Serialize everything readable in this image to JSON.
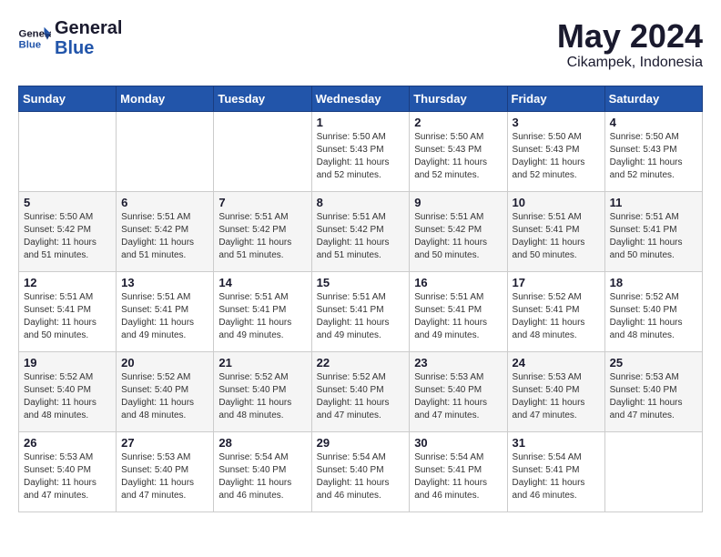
{
  "header": {
    "logo_general": "General",
    "logo_blue": "Blue",
    "month_title": "May 2024",
    "location": "Cikampek, Indonesia"
  },
  "weekdays": [
    "Sunday",
    "Monday",
    "Tuesday",
    "Wednesday",
    "Thursday",
    "Friday",
    "Saturday"
  ],
  "weeks": [
    [
      {
        "day": "",
        "info": ""
      },
      {
        "day": "",
        "info": ""
      },
      {
        "day": "",
        "info": ""
      },
      {
        "day": "1",
        "info": "Sunrise: 5:50 AM\nSunset: 5:43 PM\nDaylight: 11 hours\nand 52 minutes."
      },
      {
        "day": "2",
        "info": "Sunrise: 5:50 AM\nSunset: 5:43 PM\nDaylight: 11 hours\nand 52 minutes."
      },
      {
        "day": "3",
        "info": "Sunrise: 5:50 AM\nSunset: 5:43 PM\nDaylight: 11 hours\nand 52 minutes."
      },
      {
        "day": "4",
        "info": "Sunrise: 5:50 AM\nSunset: 5:43 PM\nDaylight: 11 hours\nand 52 minutes."
      }
    ],
    [
      {
        "day": "5",
        "info": "Sunrise: 5:50 AM\nSunset: 5:42 PM\nDaylight: 11 hours\nand 51 minutes."
      },
      {
        "day": "6",
        "info": "Sunrise: 5:51 AM\nSunset: 5:42 PM\nDaylight: 11 hours\nand 51 minutes."
      },
      {
        "day": "7",
        "info": "Sunrise: 5:51 AM\nSunset: 5:42 PM\nDaylight: 11 hours\nand 51 minutes."
      },
      {
        "day": "8",
        "info": "Sunrise: 5:51 AM\nSunset: 5:42 PM\nDaylight: 11 hours\nand 51 minutes."
      },
      {
        "day": "9",
        "info": "Sunrise: 5:51 AM\nSunset: 5:42 PM\nDaylight: 11 hours\nand 50 minutes."
      },
      {
        "day": "10",
        "info": "Sunrise: 5:51 AM\nSunset: 5:41 PM\nDaylight: 11 hours\nand 50 minutes."
      },
      {
        "day": "11",
        "info": "Sunrise: 5:51 AM\nSunset: 5:41 PM\nDaylight: 11 hours\nand 50 minutes."
      }
    ],
    [
      {
        "day": "12",
        "info": "Sunrise: 5:51 AM\nSunset: 5:41 PM\nDaylight: 11 hours\nand 50 minutes."
      },
      {
        "day": "13",
        "info": "Sunrise: 5:51 AM\nSunset: 5:41 PM\nDaylight: 11 hours\nand 49 minutes."
      },
      {
        "day": "14",
        "info": "Sunrise: 5:51 AM\nSunset: 5:41 PM\nDaylight: 11 hours\nand 49 minutes."
      },
      {
        "day": "15",
        "info": "Sunrise: 5:51 AM\nSunset: 5:41 PM\nDaylight: 11 hours\nand 49 minutes."
      },
      {
        "day": "16",
        "info": "Sunrise: 5:51 AM\nSunset: 5:41 PM\nDaylight: 11 hours\nand 49 minutes."
      },
      {
        "day": "17",
        "info": "Sunrise: 5:52 AM\nSunset: 5:41 PM\nDaylight: 11 hours\nand 48 minutes."
      },
      {
        "day": "18",
        "info": "Sunrise: 5:52 AM\nSunset: 5:40 PM\nDaylight: 11 hours\nand 48 minutes."
      }
    ],
    [
      {
        "day": "19",
        "info": "Sunrise: 5:52 AM\nSunset: 5:40 PM\nDaylight: 11 hours\nand 48 minutes."
      },
      {
        "day": "20",
        "info": "Sunrise: 5:52 AM\nSunset: 5:40 PM\nDaylight: 11 hours\nand 48 minutes."
      },
      {
        "day": "21",
        "info": "Sunrise: 5:52 AM\nSunset: 5:40 PM\nDaylight: 11 hours\nand 48 minutes."
      },
      {
        "day": "22",
        "info": "Sunrise: 5:52 AM\nSunset: 5:40 PM\nDaylight: 11 hours\nand 47 minutes."
      },
      {
        "day": "23",
        "info": "Sunrise: 5:53 AM\nSunset: 5:40 PM\nDaylight: 11 hours\nand 47 minutes."
      },
      {
        "day": "24",
        "info": "Sunrise: 5:53 AM\nSunset: 5:40 PM\nDaylight: 11 hours\nand 47 minutes."
      },
      {
        "day": "25",
        "info": "Sunrise: 5:53 AM\nSunset: 5:40 PM\nDaylight: 11 hours\nand 47 minutes."
      }
    ],
    [
      {
        "day": "26",
        "info": "Sunrise: 5:53 AM\nSunset: 5:40 PM\nDaylight: 11 hours\nand 47 minutes."
      },
      {
        "day": "27",
        "info": "Sunrise: 5:53 AM\nSunset: 5:40 PM\nDaylight: 11 hours\nand 47 minutes."
      },
      {
        "day": "28",
        "info": "Sunrise: 5:54 AM\nSunset: 5:40 PM\nDaylight: 11 hours\nand 46 minutes."
      },
      {
        "day": "29",
        "info": "Sunrise: 5:54 AM\nSunset: 5:40 PM\nDaylight: 11 hours\nand 46 minutes."
      },
      {
        "day": "30",
        "info": "Sunrise: 5:54 AM\nSunset: 5:41 PM\nDaylight: 11 hours\nand 46 minutes."
      },
      {
        "day": "31",
        "info": "Sunrise: 5:54 AM\nSunset: 5:41 PM\nDaylight: 11 hours\nand 46 minutes."
      },
      {
        "day": "",
        "info": ""
      }
    ]
  ]
}
